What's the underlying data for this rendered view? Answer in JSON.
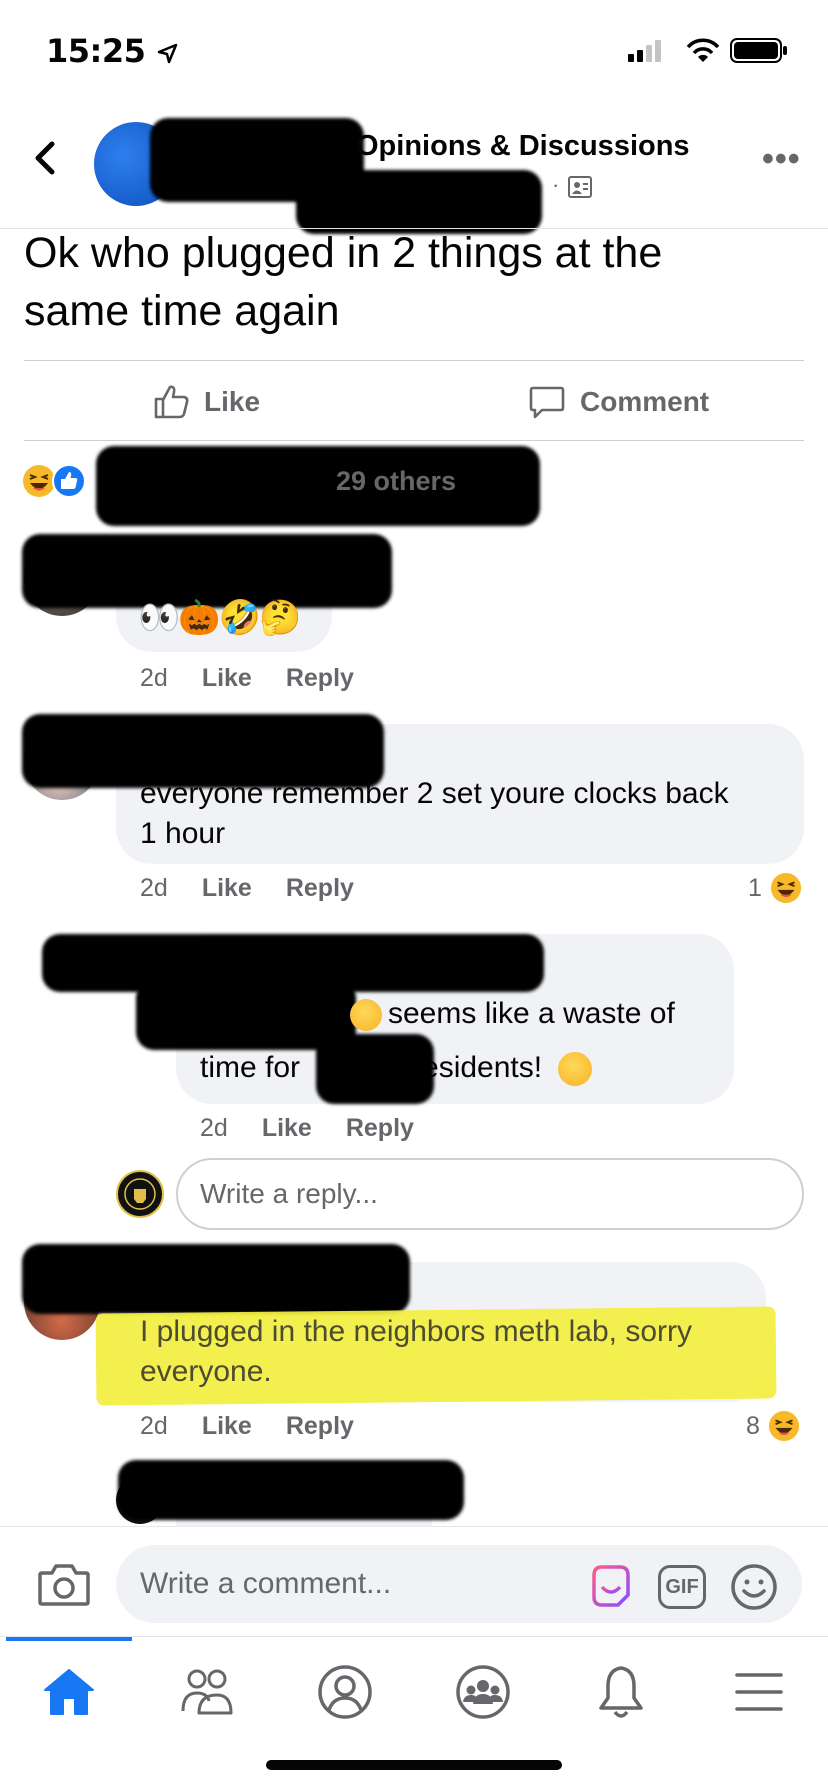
{
  "status_bar": {
    "time": "15:25"
  },
  "header": {
    "group_name": "Opinions & Discussions",
    "more_label": "•••"
  },
  "post": {
    "text_line1": "Ok who plugged in 2 things at the",
    "text_line2": "same time again"
  },
  "actions": {
    "like_label": "Like",
    "comment_label": "Comment"
  },
  "reactions": {
    "summary": "29 others"
  },
  "comments": [
    {
      "emojis": "👀🎃🤣🤔",
      "time": "2d",
      "like": "Like",
      "reply": "Reply"
    },
    {
      "text_line1": "everyone remember 2 set youre clocks back",
      "text_line2": "1 hour",
      "time": "2d",
      "like": "Like",
      "reply": "Reply",
      "reaction_count": "1"
    },
    {
      "text_line1a": "seems like a waste of",
      "text_line2a": "time for",
      "text_line2b": "residents!",
      "time": "2d",
      "like": "Like",
      "reply": "Reply"
    },
    {
      "text_line1": "I plugged in the neighbors meth lab, sorry",
      "text_line2": "everyone.",
      "time": "2d",
      "like": "Like",
      "reply": "Reply",
      "reaction_count": "8"
    }
  ],
  "reply_box": {
    "placeholder": "Write a reply..."
  },
  "composer": {
    "placeholder": "Write a comment...",
    "gif_label": "GIF"
  },
  "colors": {
    "accent": "#1877f2",
    "highlight": "#f2ef3f",
    "bubble": "#f0f2f5",
    "secondary_text": "#65676b"
  },
  "tabs": [
    "home-icon",
    "friends-icon",
    "profile-icon",
    "groups-icon",
    "notifications-icon",
    "menu-icon"
  ]
}
